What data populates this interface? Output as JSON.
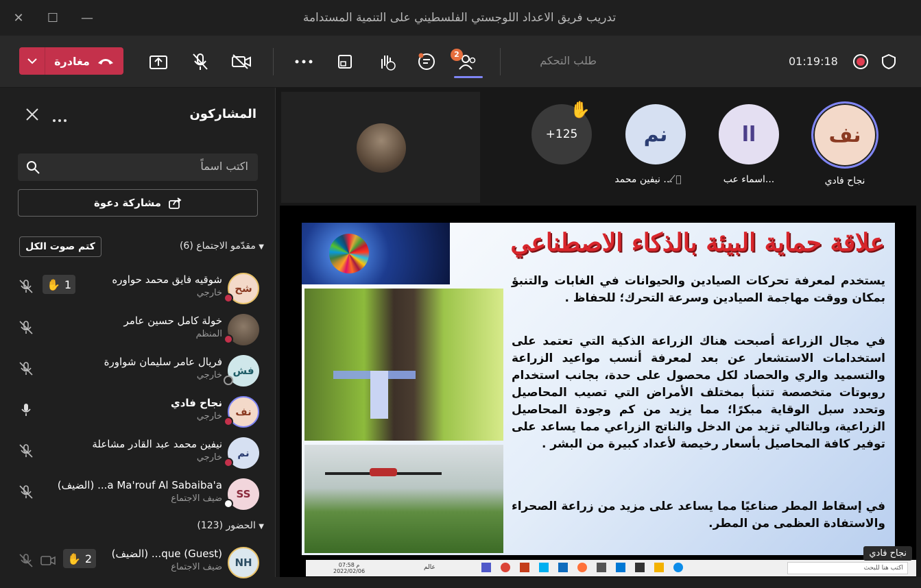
{
  "window": {
    "title": "تدريب فريق الاعداد اللوجستي الفلسطيني على التنمية المستدامة"
  },
  "toolbar": {
    "leave_label": "مغادرة",
    "people_badge": "2",
    "request_control": "طلب التحكم",
    "timer": "01:19:18",
    "icons": [
      "share-icon",
      "mic-off-icon",
      "camera-off-icon",
      "more-icon",
      "layout-icon",
      "react-icon",
      "chat-icon",
      "people-icon",
      "shield-icon"
    ]
  },
  "panel": {
    "title": "المشاركون",
    "search_placeholder": "اكتب اسماً",
    "invite_label": "مشاركة دعوة",
    "presenters_header": "مقدّمو الاجتماع (6)",
    "mute_all_label": "كتم صوت الكل",
    "attendees_header": "الحضور (123)",
    "presenters": [
      {
        "initials": "شح",
        "name": "شوقيه فايق محمد حواوره",
        "role": "خارجي",
        "hand_count": "1",
        "avatar_bg": "#f3d9c9",
        "avatar_fg": "#8a3a22"
      },
      {
        "initials": "",
        "name": "خولة كامل حسين عامر",
        "role": "المنظم",
        "avatar_bg": "#6b5a48",
        "avatar_fg": "#ffffff"
      },
      {
        "initials": "فش",
        "name": "فريال عامر سليمان شواورة",
        "role": "خارجي",
        "avatar_bg": "#cfe7ea",
        "avatar_fg": "#1e5c66"
      },
      {
        "initials": "نف",
        "name": "نجاح فادي",
        "role": "خارجي",
        "avatar_bg": "#f3d9c9",
        "avatar_fg": "#8a3a22"
      },
      {
        "initials": "نم",
        "name": "نيفين محمد عبد القادر مشاعلة",
        "role": "خارجي",
        "avatar_bg": "#d6e0f2",
        "avatar_fg": "#2c3e73"
      },
      {
        "initials": "SS",
        "name": "(الضيف) ...a Ma'rouf Al Sabaiba'a",
        "role": "ضيف الاجتماع",
        "avatar_bg": "#f2d6dc",
        "avatar_fg": "#8a2a3c"
      }
    ],
    "attendees": [
      {
        "initials": "NH",
        "name": "(الضيف) ...que (Guest)",
        "role": "ضيف الاجتماع",
        "hand_count": "2",
        "avatar_bg": "#dbe7ee",
        "avatar_fg": "#2c4d63"
      }
    ]
  },
  "stage": {
    "overflow_count": "+125",
    "tiles": [
      {
        "initials": "نف",
        "name": "نجاح فادي",
        "bg": "#f3d9c9",
        "fg": "#8a3a22"
      },
      {
        "initials": "اا",
        "name": "اسماء عب...",
        "bg": "#e4dff2",
        "fg": "#4c3f8a"
      },
      {
        "initials": "نم",
        "name": "نيفين محمد ...",
        "bg": "#d6e0f2",
        "fg": "#2c3e73"
      }
    ],
    "presenter_tag": "نجاح فادي"
  },
  "slide": {
    "title": "علاقة حماية البيئة بالذكاء الاصطناعي",
    "p1": "يستخدم لمعرفة تحركات الصيادين والحيوانات في الغابات والتنبؤ بمكان ووقت مهاجمة الصيادين وسرعة التحرك؛ للحفاظ .",
    "p2": "في مجال الزراعة أصبحت هناك الزراعة الذكية التي تعتمد على استخدامات الاستشعار عن بعد لمعرفة أنسب مواعيد الزراعة والتسميد والري والحصاد لكل محصول على حدة، بجانب استخدام روبوتات متخصصة تتنبأ بمختلف الأمراض التي تصيب المحاصيل وتحدد سبل الوقاية مبكرًا؛ مما يزيد من كم وجودة المحاصيل الزراعية، وبالتالي تزيد من الدخل والناتج الزراعي مما يساعد على توفير كافة المحاصيل بأسعار رخيصة لأعداد كبيرة من البشر .",
    "p3": "في إسقاط المطر صناعيًا مما يساعد على مزيد من زراعة الصحراء والاستفادة العظمى من المطر."
  },
  "taskbar": {
    "search": "اكتب هنا للبحث",
    "clock": "07:58 م",
    "date": "2022/02/06",
    "lang": "عالم"
  }
}
